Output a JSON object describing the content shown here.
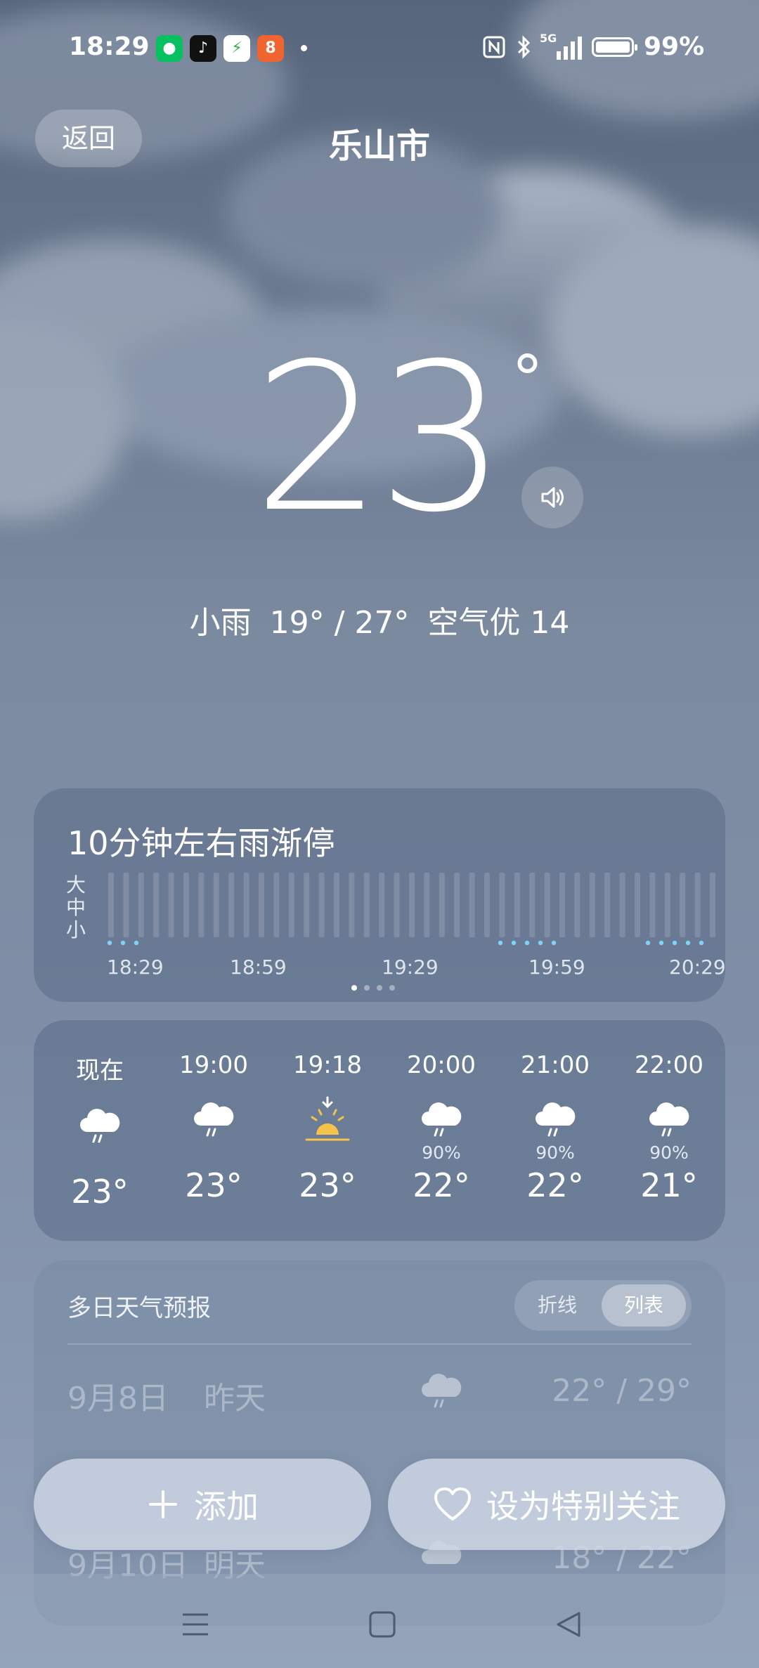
{
  "status_bar": {
    "time": "18:29",
    "apps": [
      {
        "icon": "wechat-icon",
        "color": "#07c160",
        "glyph": "◍"
      },
      {
        "icon": "tiktok-icon",
        "color": "#111111",
        "glyph": "♪"
      },
      {
        "icon": "security-shield-icon",
        "color": "#ffffff",
        "glyph": "⚡"
      },
      {
        "icon": "video-app-icon",
        "color": "#f0652f",
        "glyph": "8"
      }
    ],
    "network": "5G",
    "battery": "99%"
  },
  "header": {
    "back_label": "返回",
    "city": "乐山市"
  },
  "current": {
    "temperature": "23",
    "degree_symbol": "°",
    "condition": "小雨",
    "low_high": "19° / 27°",
    "air_quality": "空气优 14"
  },
  "precipitation": {
    "title": "10分钟左右雨渐停",
    "y_labels": [
      "大",
      "中",
      "小"
    ],
    "x_labels": [
      "18:29",
      "18:59",
      "19:29",
      "19:59",
      "20:29"
    ],
    "page_count": 4,
    "active_page": 0
  },
  "hourly": [
    {
      "time": "现在",
      "icon": "rain-cloud-icon",
      "prob": "",
      "temp": "23°"
    },
    {
      "time": "19:00",
      "icon": "rain-cloud-icon",
      "prob": "",
      "temp": "23°"
    },
    {
      "time": "19:18",
      "icon": "sunset-icon",
      "prob": "",
      "temp": "23°"
    },
    {
      "time": "20:00",
      "icon": "rain-cloud-icon",
      "prob": "90%",
      "temp": "22°"
    },
    {
      "time": "21:00",
      "icon": "rain-cloud-icon",
      "prob": "90%",
      "temp": "22°"
    },
    {
      "time": "22:00",
      "icon": "rain-cloud-icon",
      "prob": "90%",
      "temp": "21°"
    }
  ],
  "daily": {
    "title": "多日天气预报",
    "toggle_line": "折线",
    "toggle_list": "列表",
    "rows": [
      {
        "date": "9月8日",
        "day": "昨天",
        "icon": "rain-cloud-icon",
        "temps": "22° / 29°"
      },
      {
        "date": "9月10日",
        "day": "明天",
        "icon": "cloud-icon",
        "temps": "18° / 22°"
      }
    ]
  },
  "actions": {
    "add_label": "添加",
    "follow_label": "设为特别关注"
  }
}
